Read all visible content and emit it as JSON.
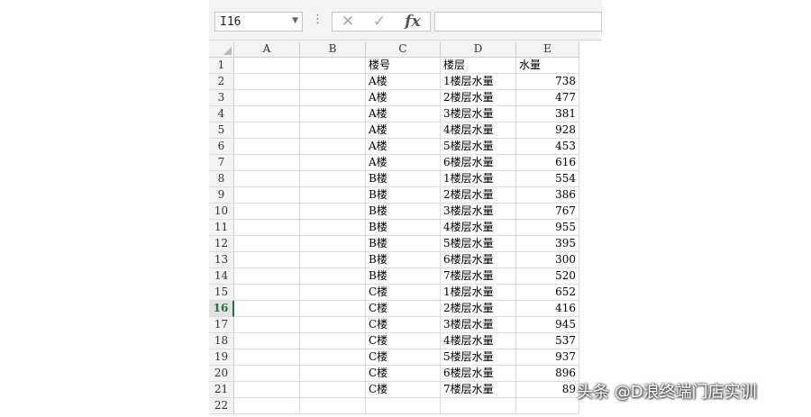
{
  "formula_bar": {
    "name_box": "I16",
    "cancel_icon": "x-icon",
    "enter_icon": "check-icon",
    "fx_label": "fx",
    "formula_value": ""
  },
  "columns": [
    "A",
    "B",
    "C",
    "D",
    "E"
  ],
  "selected_row": "16",
  "rows": [
    {
      "n": "1",
      "A": "",
      "B": "",
      "C": "楼号",
      "D": "楼层",
      "E": "水量"
    },
    {
      "n": "2",
      "A": "",
      "B": "",
      "C": "A楼",
      "D": "1楼层水量",
      "E": "738"
    },
    {
      "n": "3",
      "A": "",
      "B": "",
      "C": "A楼",
      "D": "2楼层水量",
      "E": "477"
    },
    {
      "n": "4",
      "A": "",
      "B": "",
      "C": "A楼",
      "D": "3楼层水量",
      "E": "381"
    },
    {
      "n": "5",
      "A": "",
      "B": "",
      "C": "A楼",
      "D": "4楼层水量",
      "E": "928"
    },
    {
      "n": "6",
      "A": "",
      "B": "",
      "C": "A楼",
      "D": "5楼层水量",
      "E": "453"
    },
    {
      "n": "7",
      "A": "",
      "B": "",
      "C": "A楼",
      "D": "6楼层水量",
      "E": "616"
    },
    {
      "n": "8",
      "A": "",
      "B": "",
      "C": "B楼",
      "D": "1楼层水量",
      "E": "554"
    },
    {
      "n": "9",
      "A": "",
      "B": "",
      "C": "B楼",
      "D": "2楼层水量",
      "E": "386"
    },
    {
      "n": "10",
      "A": "",
      "B": "",
      "C": "B楼",
      "D": "3楼层水量",
      "E": "767"
    },
    {
      "n": "11",
      "A": "",
      "B": "",
      "C": "B楼",
      "D": "4楼层水量",
      "E": "955"
    },
    {
      "n": "12",
      "A": "",
      "B": "",
      "C": "B楼",
      "D": "5楼层水量",
      "E": "395"
    },
    {
      "n": "13",
      "A": "",
      "B": "",
      "C": "B楼",
      "D": "6楼层水量",
      "E": "300"
    },
    {
      "n": "14",
      "A": "",
      "B": "",
      "C": "B楼",
      "D": "7楼层水量",
      "E": "520"
    },
    {
      "n": "15",
      "A": "",
      "B": "",
      "C": "C楼",
      "D": "1楼层水量",
      "E": "652"
    },
    {
      "n": "16",
      "A": "",
      "B": "",
      "C": "C楼",
      "D": "2楼层水量",
      "E": "416"
    },
    {
      "n": "17",
      "A": "",
      "B": "",
      "C": "C楼",
      "D": "3楼层水量",
      "E": "945"
    },
    {
      "n": "18",
      "A": "",
      "B": "",
      "C": "C楼",
      "D": "4楼层水量",
      "E": "537"
    },
    {
      "n": "19",
      "A": "",
      "B": "",
      "C": "C楼",
      "D": "5楼层水量",
      "E": "937"
    },
    {
      "n": "20",
      "A": "",
      "B": "",
      "C": "C楼",
      "D": "6楼层水量",
      "E": "896"
    },
    {
      "n": "21",
      "A": "",
      "B": "",
      "C": "C楼",
      "D": "7楼层水量",
      "E": "89"
    },
    {
      "n": "22",
      "A": "",
      "B": "",
      "C": "",
      "D": "",
      "E": ""
    }
  ],
  "watermark": "头条 @D浪终端门店实训",
  "colors": {
    "header_bg": "#f3f3f3",
    "grid": "#dcdcdc",
    "selected_accent": "#217346"
  }
}
